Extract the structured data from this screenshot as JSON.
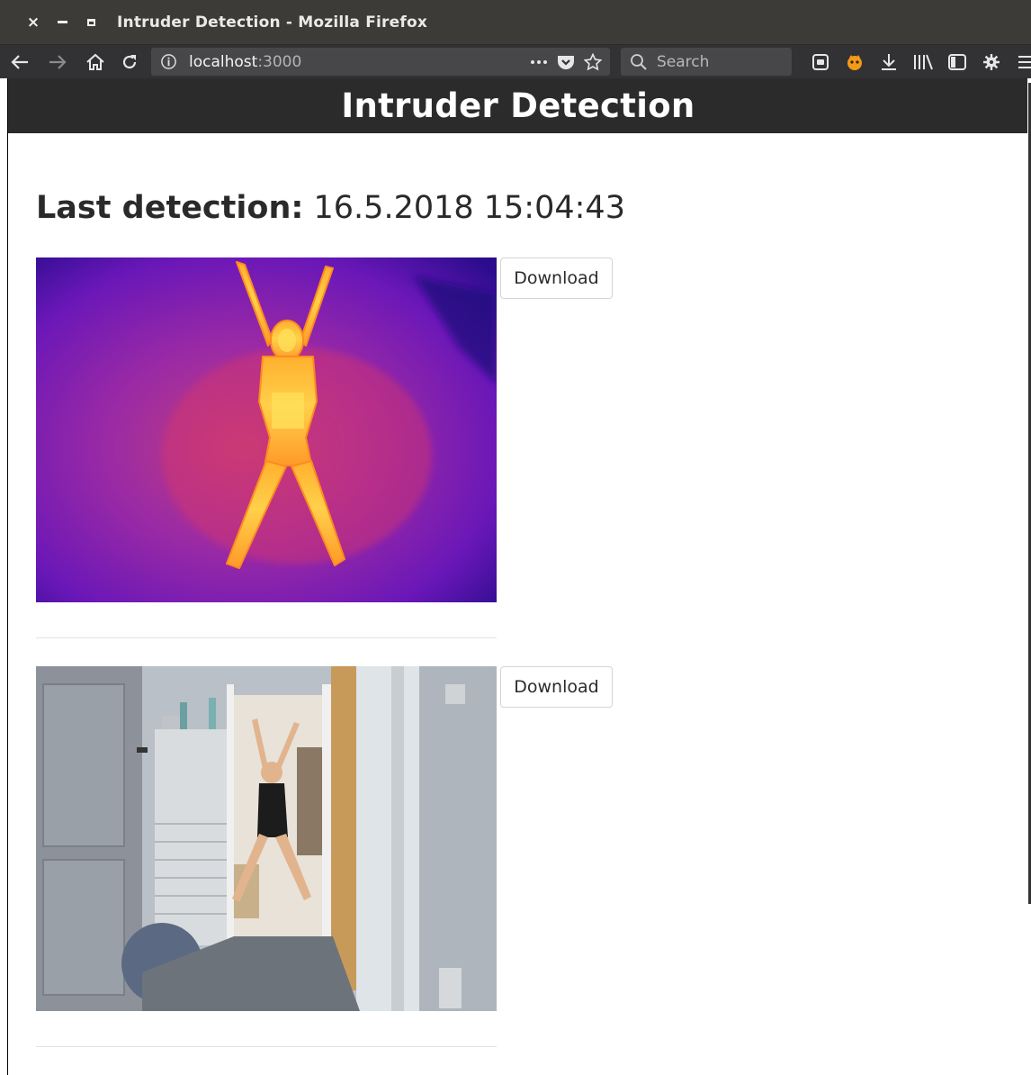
{
  "window": {
    "title": "Intruder Detection - Mozilla Firefox",
    "close_symbol": "×"
  },
  "browser": {
    "url_host": "localhost",
    "url_port": ":3000",
    "search_placeholder": "Search",
    "icons": [
      "back-arrow-icon",
      "forward-arrow-icon",
      "home-icon",
      "reload-icon",
      "info-icon",
      "more-icon",
      "pocket-icon",
      "star-icon",
      "search-icon",
      "reader-icon",
      "extension-icon",
      "download-icon",
      "library-icon",
      "sidebar-icon",
      "gear-icon",
      "menu-icon"
    ]
  },
  "app": {
    "title": "Intruder Detection"
  },
  "detection": {
    "label": "Last detection:",
    "timestamp": "16.5.2018 15:04:43"
  },
  "images": [
    {
      "kind": "thermal",
      "download_label": "Download"
    },
    {
      "kind": "camera",
      "download_label": "Download"
    }
  ],
  "colors": {
    "header_bg": "#2b2b2b",
    "thermal_cold": "#6a17b8",
    "thermal_mid": "#d8356a",
    "thermal_hot": "#ffe25a"
  }
}
